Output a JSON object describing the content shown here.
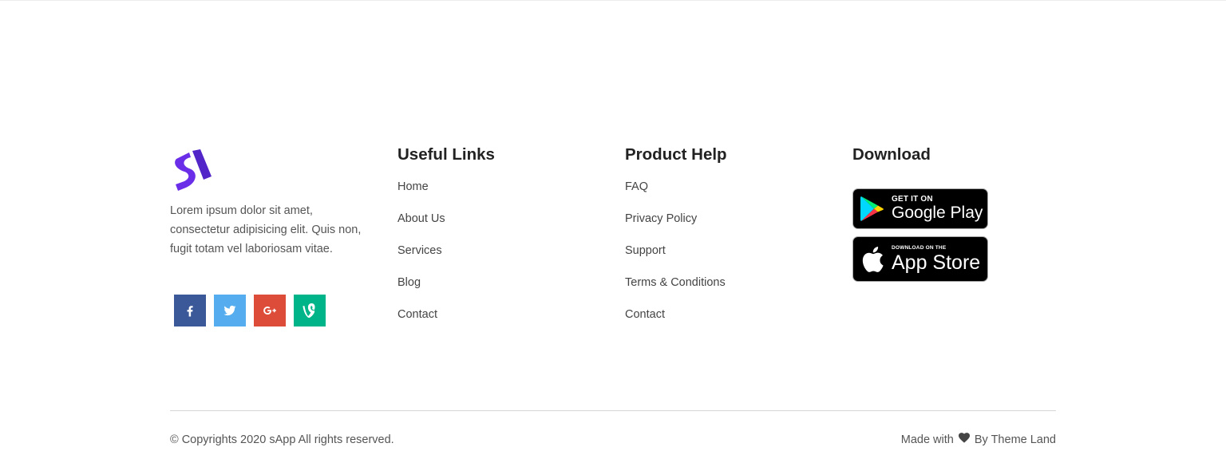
{
  "brand": {
    "about": "Lorem ipsum dolor sit amet, consectetur adipisicing elit. Quis non, fugit totam vel laboriosam vitae.",
    "logo_color": "#6a2ee8"
  },
  "socials": [
    {
      "icon": "facebook-icon",
      "color": "#3b5998"
    },
    {
      "icon": "twitter-icon",
      "color": "#55acee"
    },
    {
      "icon": "google-plus-icon",
      "color": "#dd4b39"
    },
    {
      "icon": "vine-icon",
      "color": "#00b489"
    }
  ],
  "useful_links": {
    "title": "Useful Links",
    "items": [
      "Home",
      "About Us",
      "Services",
      "Blog",
      "Contact"
    ]
  },
  "product_help": {
    "title": "Product Help",
    "items": [
      "FAQ",
      "Privacy Policy",
      "Support",
      "Terms & Conditions",
      "Contact"
    ]
  },
  "download": {
    "title": "Download",
    "google_play": {
      "small": "GET IT ON",
      "big": "Google Play"
    },
    "app_store": {
      "small": "DOWNLOAD ON THE",
      "big": "App Store"
    }
  },
  "footer": {
    "copyright": "© Copyrights 2020 sApp All rights reserved.",
    "made_with_prefix": "Made with",
    "made_with_suffix": "By Theme Land"
  }
}
